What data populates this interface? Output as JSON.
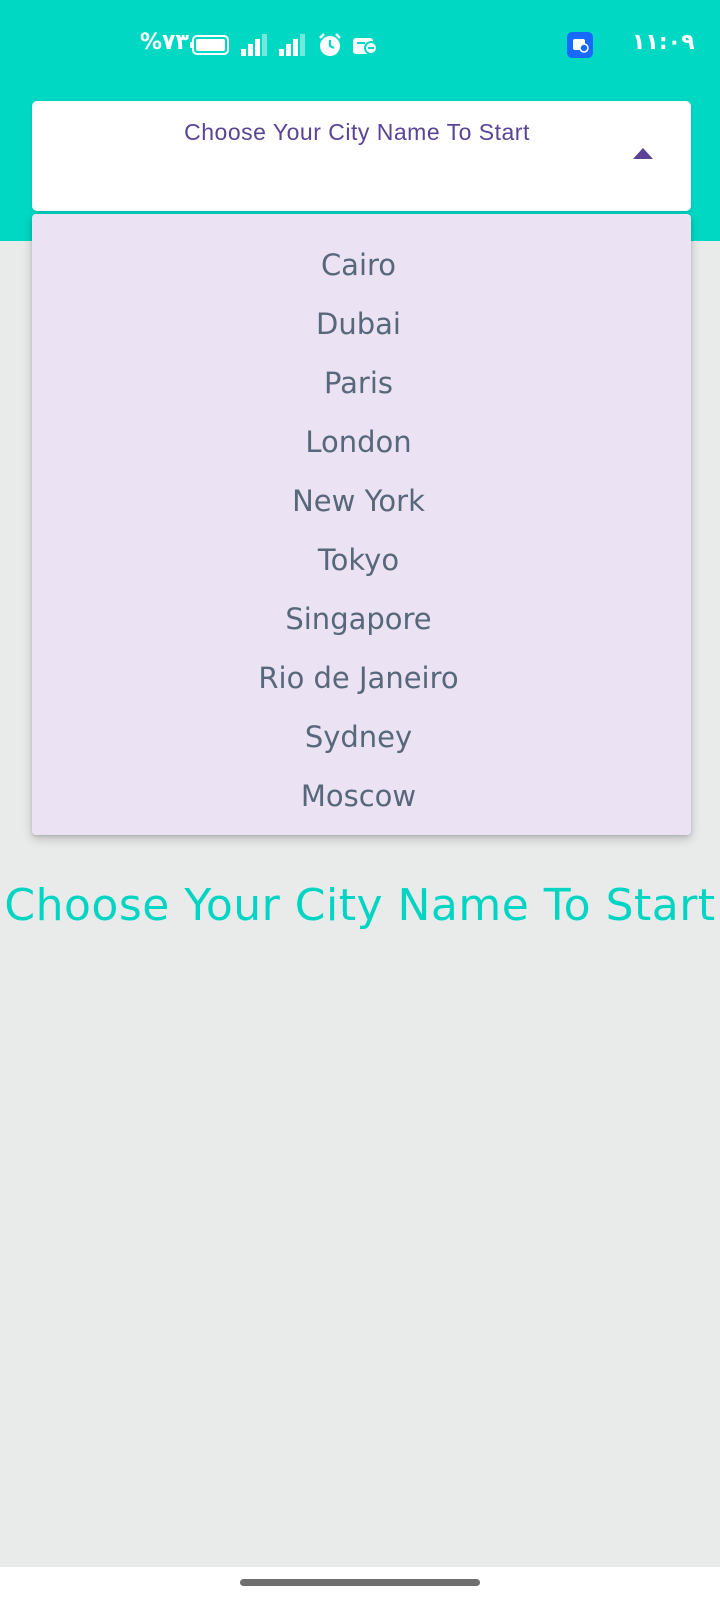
{
  "status_bar": {
    "battery_percent": "%٧٣",
    "time": "١١:٠٩",
    "icons": [
      "battery-icon",
      "signal-icon",
      "signal-icon",
      "alarm-icon",
      "notification-icon",
      "app-badge-icon"
    ]
  },
  "dropdown": {
    "hint": "Choose Your City Name To Start",
    "state": "expanded",
    "arrow_icon": "caret-up-icon",
    "options": [
      "Cairo",
      "Dubai",
      "Paris",
      "London",
      "New York",
      "Tokyo",
      "Singapore",
      "Rio de Janeiro",
      "Sydney",
      "Moscow"
    ]
  },
  "main": {
    "title": "Choose Your City Name To Start"
  },
  "colors": {
    "header": "#00d8c4",
    "background": "#e9ebea",
    "menu_background": "#ebe2f3",
    "hint_text": "#5b4396",
    "menu_text": "#56687a",
    "title_text": "#00d5c3"
  }
}
